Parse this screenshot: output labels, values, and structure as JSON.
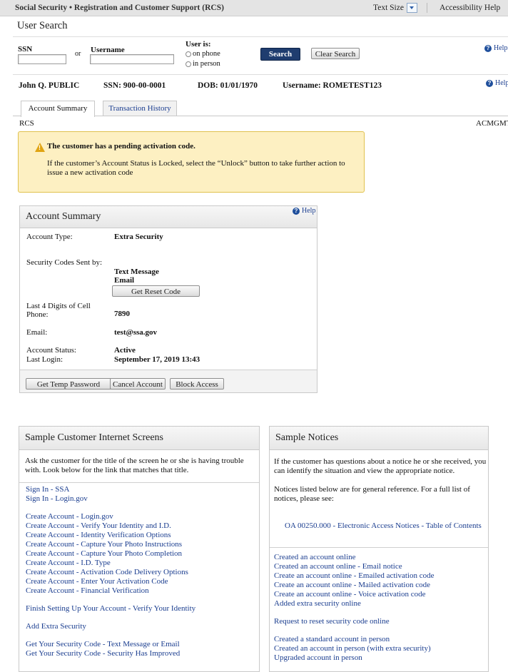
{
  "topbar": {
    "app_title": "Social Security • Registration and Customer Support (RCS)",
    "text_size": "Text Size",
    "accessibility_help": "Accessibility Help"
  },
  "page_title": "User Search",
  "search": {
    "ssn_label": "SSN",
    "or": "or",
    "username_label": "Username",
    "user_is_label": "User is:",
    "on_phone": "on phone",
    "in_person": "in person",
    "search_button": "Search",
    "clear_button": "Clear Search",
    "help": "Help"
  },
  "customer": {
    "name": "John Q. PUBLIC",
    "ssn": "SSN:  900-00-0001",
    "dob": "DOB: 01/01/1970",
    "username_label": "Username:",
    "username": "ROMETEST123",
    "help": "Help"
  },
  "tabs": [
    {
      "label": "Account Summary"
    },
    {
      "label": "Transaction History"
    }
  ],
  "context": {
    "left": "RCS",
    "right": "ACMGMT"
  },
  "alert": {
    "title": "The customer has a pending activation code.",
    "body": "If the customer’s Account Status is Locked, select the “Unlock” button to take further action to issue a new activation code"
  },
  "account_summary": {
    "title": "Account Summary",
    "help": "Help",
    "account_type_label": "Account Type:",
    "account_type": "Extra Security",
    "codes_sent_label": "Security Codes Sent by:",
    "codes_method1": "Text Message",
    "codes_method2": "Email",
    "get_reset_code": "Get Reset Code",
    "cell_label_1": "Last 4 Digits of Cell",
    "cell_label_2": "Phone:",
    "cell_value": "7890",
    "email_label": "Email:",
    "email_value": "test@ssa.gov",
    "status_label": "Account Status:",
    "status_value": "Active",
    "last_login_label": "Last Login:",
    "last_login_value": "September 17, 2019 13:43",
    "buttons": {
      "temp_password": "Get Temp Password",
      "cancel": "Cancel Account",
      "block": "Block Access"
    }
  },
  "internet_screens": {
    "title": "Sample Customer Internet Screens",
    "intro": "Ask the customer for the title of the screen he or she is having trouble with. Look below for the link that matches that title.",
    "links": [
      "Sign In - SSA",
      "Sign In - Login.gov",
      "Create Account - Login.gov",
      "Create Account - Verify Your Identity and I.D.",
      "Create Account - Identity Verification Options",
      "Create Account - Capture Your Photo Instructions",
      "Create Account - Capture Your Photo Completion",
      "Create Account - I.D. Type",
      "Create Account - Activation Code Delivery Options",
      "Create Account - Enter Your Activation Code",
      "Create Account - Financial Verification",
      "Finish Setting Up Your Account - Verify Your Identity",
      "Add Extra Security",
      "Get Your Security Code - Text Message or Email",
      "Get Your Security Code - Security Has Improved"
    ]
  },
  "notices": {
    "title": "Sample Notices",
    "intro": "If the customer has questions about a notice he or she received, you can identify the situation and view the appropriate notice.",
    "intro2": "Notices listed below are for general reference. For a full list of notices, please see:",
    "toc_link": "OA 00250.000 - Electronic Access Notices - Table of Contents",
    "links": [
      "Created an account online",
      "Created an account online - Email notice",
      "Create an account online - Emailed activation code",
      "Create an account online - Mailed activation code",
      "Create an account online - Voice activation code",
      "Added extra security online",
      "Request to reset security code online",
      "Created a standard account in person",
      "Created an account in person (with extra security)",
      "Upgraded account in person"
    ]
  }
}
